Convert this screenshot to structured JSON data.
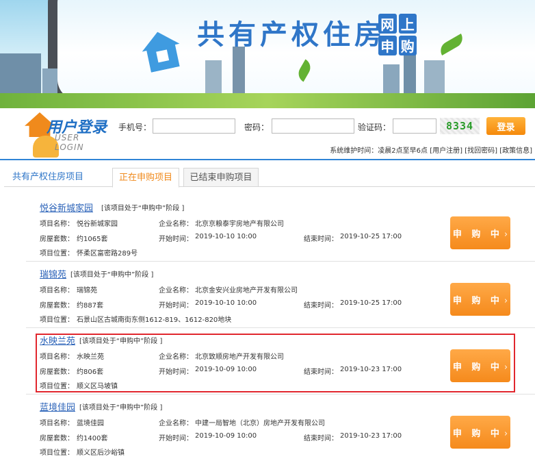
{
  "banner": {
    "title": "共有产权住房",
    "badge": [
      "网",
      "上",
      "申",
      "购"
    ]
  },
  "login": {
    "logo_cn": "用户登录",
    "logo_en": "USER LOGIN",
    "phone_label": "手机号：",
    "password_label": "密码：",
    "captcha_label": "验证码：",
    "captcha_value": "8334",
    "login_button": "登录",
    "maintenance": "系统维护时间：凌晨2点至早6点",
    "links": [
      "用户注册",
      "找回密码",
      "政策信息"
    ]
  },
  "tabs": {
    "home": "共有产权住房项目",
    "active": "正在申购项目",
    "closed": "已结束申购项目"
  },
  "labels": {
    "project_name": "项目名称：",
    "company": "企业名称：",
    "units": "房屋套数：",
    "start": "开始时间：",
    "end": "结束时间：",
    "location": "项目位置：",
    "apply_button": "申 购 中",
    "apply_chevron": "›"
  },
  "projects": [
    {
      "title": "悦谷新城家园",
      "stage": "[该项目处于“申购中”阶段 ]",
      "name": "悦谷新城家园",
      "company": "北京京粮泰宇房地产有限公司",
      "units": "约1065套",
      "start": "2019-10-10 10:00",
      "end": "2019-10-25 17:00",
      "location": "怀柔区富密路289号"
    },
    {
      "title": "瑞锦苑",
      "stage": "[该项目处于“申购中”阶段 ]",
      "name": "瑞锦苑",
      "company": "北京金安兴业房地产开发有限公司",
      "units": "约887套",
      "start": "2019-10-10 10:00",
      "end": "2019-10-25 17:00",
      "location": "石景山区古城南街东侧1612-819、1612-820地块"
    },
    {
      "title": "水映兰苑",
      "stage": "[该项目处于“申购中”阶段 ]",
      "name": "水映兰苑",
      "company": "北京致顺房地产开发有限公司",
      "units": "约806套",
      "start": "2019-10-09 10:00",
      "end": "2019-10-23 17:00",
      "location": "顺义区马坡镇"
    },
    {
      "title": "蓝境佳园",
      "stage": "[该项目处于“申购中”阶段 ]",
      "name": "蓝境佳园",
      "company": "中建一局智地（北京）房地产开发有限公司",
      "units": "约1400套",
      "start": "2019-10-09 10:00",
      "end": "2019-10-23 17:00",
      "location": "顺义区后沙峪镇"
    }
  ],
  "colors": {
    "brand_blue": "#2f76c8",
    "accent_orange": "#f58a1c",
    "highlight_red": "#e1262d"
  }
}
